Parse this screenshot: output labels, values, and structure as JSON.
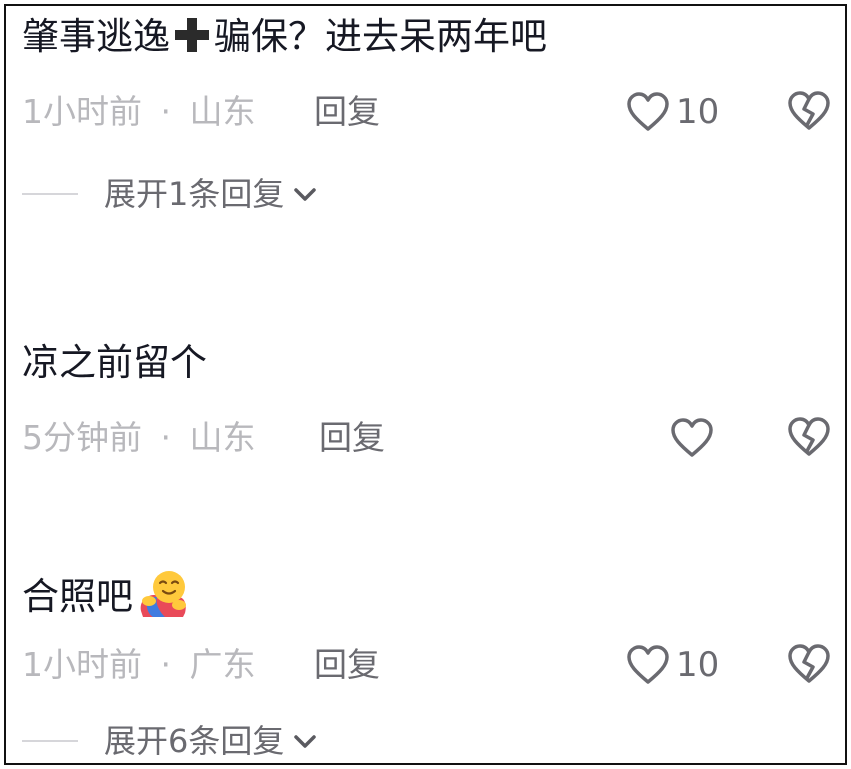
{
  "comments": [
    {
      "text_before": "肇事逃逸",
      "text_after": "骗保？进去呆两年吧",
      "time": "1小时前",
      "separator": "·",
      "location": "山东",
      "reply_label": "回复",
      "likes": "10",
      "expand_label": "展开1条回复"
    },
    {
      "text": "凉之前留个",
      "time": "5分钟前",
      "separator": "·",
      "location": "山东",
      "reply_label": "回复"
    },
    {
      "text": "合照吧",
      "time": "1小时前",
      "separator": "·",
      "location": "广东",
      "reply_label": "回复",
      "likes": "10",
      "expand_label": "展开6条回复"
    }
  ],
  "icons": {
    "like": "heart-outline-icon",
    "dislike": "broken-heart-icon",
    "expand": "chevron-down-icon",
    "plus": "heavy-plus-icon",
    "hug": "hugging-face-emoji"
  },
  "colors": {
    "text": "#161823",
    "meta": "#b8b8bc",
    "secondary": "#6a6a70"
  }
}
